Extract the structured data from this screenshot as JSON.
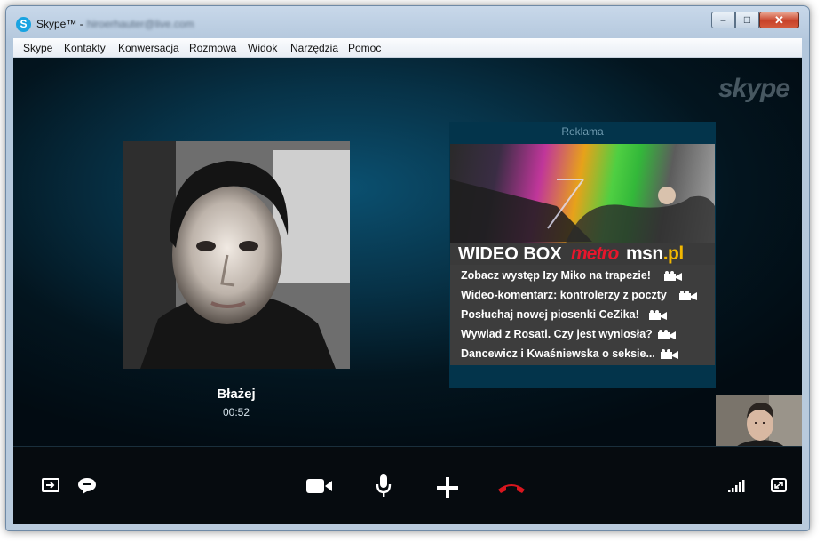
{
  "window": {
    "title": "Skype™ -",
    "account": "hiroerhauter@live.com",
    "buttons": {
      "minimize": "–",
      "maximize": "□",
      "close": "✕"
    }
  },
  "menu": [
    "Skype",
    "Kontakty",
    "Konwersacja",
    "Rozmowa",
    "Widok",
    "Narzędzia",
    "Pomoc"
  ],
  "brand_watermark": "skype",
  "call": {
    "caller_name": "Błażej",
    "duration": "00:52"
  },
  "ad": {
    "label": "Reklama",
    "brand": {
      "left": "WIDEO BOX",
      "metro": "metro",
      "msn": "msn",
      "msn_tld": ".pl"
    },
    "items": [
      "Zobacz występ Izy Miko na trapezie!",
      "Wideo-komentarz: kontrolerzy z poczty",
      "Posłuchaj nowej piosenki CeZika!",
      "Wywiad z Rosati. Czy jest wyniosła?",
      "Dancewicz i Kwaśniewska o seksie..."
    ]
  },
  "controls": {
    "icons": [
      "screen-share-icon",
      "chat-icon",
      "video-camera-icon",
      "microphone-icon",
      "add-icon",
      "hang-up-icon",
      "signal-strength-icon",
      "fullscreen-icon"
    ]
  },
  "colors": {
    "hangup": "#d9161e",
    "stage_center": "#0b5070",
    "stage_edge": "#020b12",
    "ad_background": "#3d3d3d",
    "metro_red": "#e8162c"
  }
}
